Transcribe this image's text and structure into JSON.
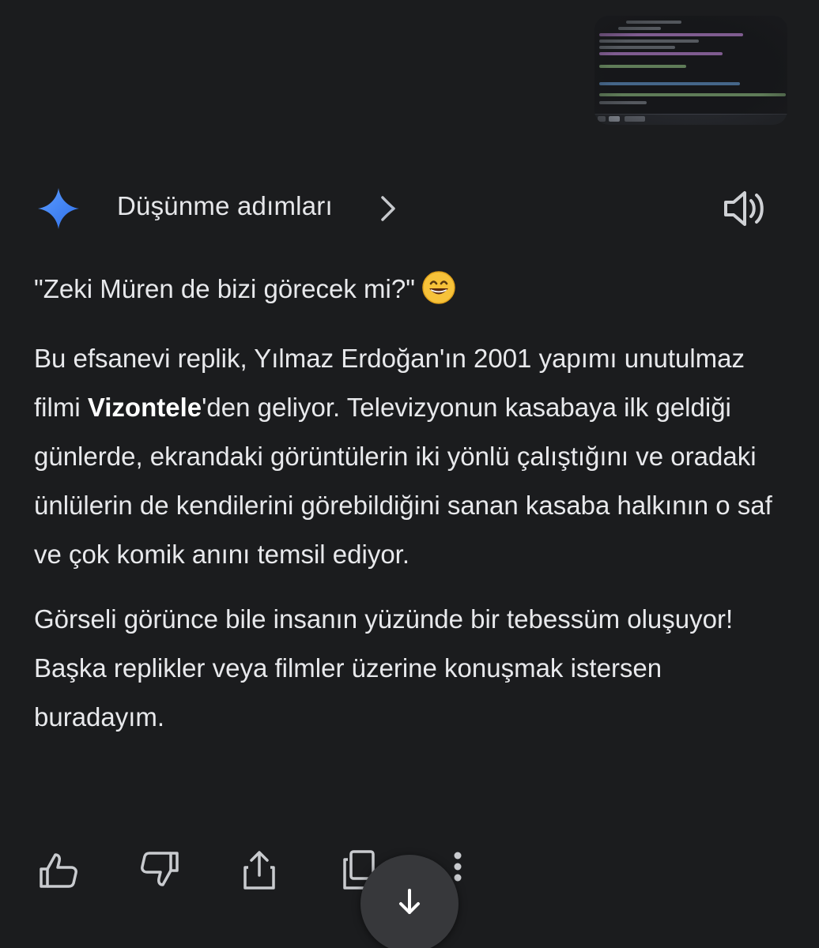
{
  "attachment": {
    "label": "screenshot thumbnail"
  },
  "header": {
    "thinking_label": "Düşünme adımları"
  },
  "response": {
    "quote": "\"Zeki Müren de bizi görecek mi?\"",
    "p1_before": "Bu efsanevi replik, Yılmaz Erdoğan'ın 2001 yapımı unutulmaz filmi ",
    "p1_bold": "Vizontele",
    "p1_after": "'den geliyor. Televizyonun kasabaya ilk geldiği günlerde, ekrandaki görüntülerin iki yönlü çalıştığını ve oradaki ünlülerin de kendilerini görebildiğini sanan kasaba halkının o saf ve çok komik anını temsil ediyor.",
    "p2": "Görseli görünce bile insanın yüzünde bir tebessüm oluşuyor! Başka replikler veya filmler üzerine konuşmak istersen buradayım."
  },
  "icons": {
    "sparkle": "gemini-sparkle-icon",
    "chevron": "chevron-right-icon",
    "speaker": "speaker-icon",
    "emoji": "grinning-face-emoji",
    "like": "thumbs-up-icon",
    "dislike": "thumbs-down-icon",
    "share": "share-icon",
    "copy": "copy-icon",
    "more": "more-vertical-icon",
    "scroll": "arrow-down-icon"
  },
  "colors": {
    "background": "#1b1c1e",
    "text": "#e6e7ea",
    "sparkle_blue": "#4a8cf7",
    "scroll_button": "#37383b"
  }
}
